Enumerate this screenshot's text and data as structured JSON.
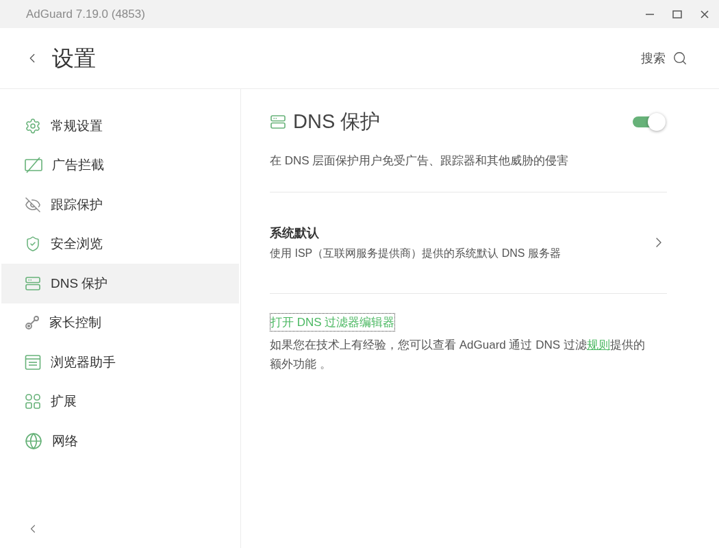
{
  "window": {
    "title": "AdGuard 7.19.0 (4853)"
  },
  "header": {
    "title": "设置",
    "search_label": "搜索"
  },
  "sidebar": {
    "items": [
      {
        "label": "常规设置",
        "enabled": true,
        "selected": false
      },
      {
        "label": "广告拦截",
        "enabled": true,
        "selected": false
      },
      {
        "label": "跟踪保护",
        "enabled": false,
        "selected": false
      },
      {
        "label": "安全浏览",
        "enabled": true,
        "selected": false
      },
      {
        "label": "DNS 保护",
        "enabled": true,
        "selected": true
      },
      {
        "label": "家长控制",
        "enabled": false,
        "selected": false
      },
      {
        "label": "浏览器助手",
        "enabled": true,
        "selected": false
      },
      {
        "label": "扩展",
        "enabled": true,
        "selected": false
      },
      {
        "label": "网络",
        "enabled": true,
        "selected": false
      }
    ]
  },
  "content": {
    "title": "DNS 保护",
    "toggle_on": true,
    "description": "在 DNS 层面保护用户免受广告、跟踪器和其他威胁的侵害",
    "server": {
      "title": "系统默认",
      "subtitle": "使用 ISP（互联网服务提供商）提供的系统默认 DNS 服务器"
    },
    "editor_link": "打开 DNS 过滤器编辑器",
    "note": {
      "before": "如果您在技术上有经验，您可以查看 AdGuard 通过 DNS 过滤",
      "link": "规则",
      "after": "提供的额外功能 。"
    }
  }
}
